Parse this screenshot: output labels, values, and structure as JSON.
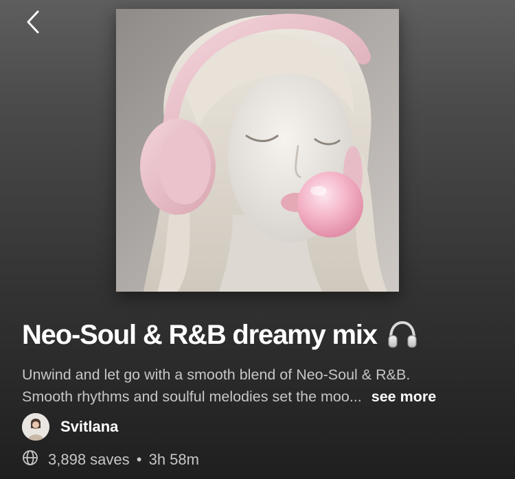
{
  "header": {
    "back_icon": "chevron-left-icon"
  },
  "cover": {
    "description_icon": "playlist-cover-image"
  },
  "playlist": {
    "title": "Neo-Soul & R&B dreamy mix",
    "title_emoji": "headphones-icon",
    "description_line1": "Unwind and let go with a smooth blend of Neo-Soul & R&B.",
    "description_line2": "Smooth rhythms and soulful melodies set the moo...",
    "see_more": "see more"
  },
  "owner": {
    "name": "Svitlana",
    "avatar_icon": "avatar"
  },
  "meta": {
    "globe_icon": "globe-icon",
    "saves": "3,898 saves",
    "separator": "•",
    "duration": "3h 58m"
  },
  "colors": {
    "background_top": "#5e5e5e",
    "background_bottom": "#1f1f1f",
    "text_primary": "#ffffff",
    "text_secondary": "#c7c7c7",
    "cover_bubble": "#f2a9bd"
  }
}
